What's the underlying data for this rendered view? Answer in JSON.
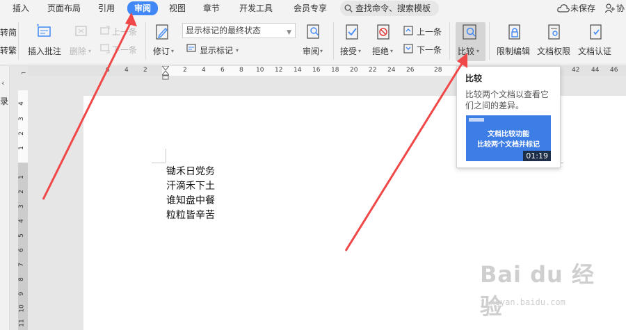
{
  "menu": {
    "items": [
      "插入",
      "页面布局",
      "引用",
      "审阅",
      "视图",
      "章节",
      "开发工具",
      "会员专享"
    ],
    "active": "审阅",
    "search": "查找命令、搜索模板",
    "unsaved": "未保存",
    "collab": "协"
  },
  "ribbon": {
    "left_clipped_1": "转简",
    "left_clipped_2": "转繁",
    "insert_comment": "插入批注",
    "delete": "删除",
    "prev_comment": "上一条",
    "next_comment": "下一条",
    "revise": "修订",
    "display_select": "显示标记的最终状态",
    "show_marks": "显示标记",
    "review": "审阅",
    "accept": "接受",
    "reject": "拒绝",
    "prev_change": "上一条",
    "next_change": "下一条",
    "compare": "比较",
    "restrict_edit": "限制编辑",
    "doc_permission": "文档权限",
    "doc_certify": "文档认证"
  },
  "ruler": {
    "ticks": [
      "6",
      "4",
      "2",
      "2",
      "4",
      "6",
      "8",
      "10",
      "12",
      "14",
      "16",
      "18",
      "20",
      "22",
      "24",
      "26",
      "28",
      "42",
      "44",
      "46"
    ],
    "vticks_top": [
      "4",
      "3",
      "2",
      "1"
    ],
    "vticks_bottom": [
      "1",
      "2",
      "3",
      "4",
      "5",
      "6",
      "7",
      "8",
      "9",
      "10",
      "11"
    ]
  },
  "left_pane": {
    "label": "录"
  },
  "document": {
    "lines": [
      "锄禾日党务",
      "汗滴禾下土",
      "谁知盘中餐",
      "粒粒皆辛苦"
    ]
  },
  "tooltip": {
    "title": "比较",
    "description": "比较两个文档以查看它们之间的差异。",
    "video_line1": "文档比较功能",
    "video_line2": "比较两个文档并标记",
    "video_duration": "01:19"
  },
  "watermark": {
    "text": "Bai du 经验",
    "sub": "jingyan.baidu.com"
  },
  "colors": {
    "accent": "#3f88f5",
    "arrow": "#f04848",
    "video_bg": "#3d7de6"
  }
}
